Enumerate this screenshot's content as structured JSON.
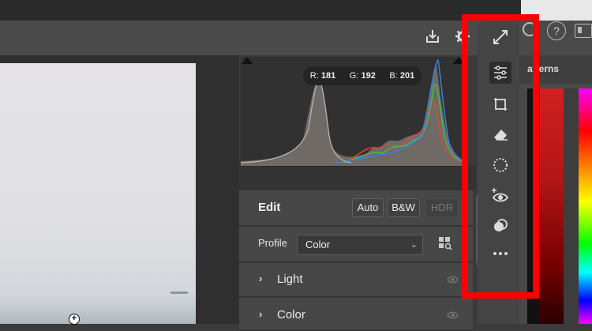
{
  "histogram": {
    "readout": {
      "r_label": "R:",
      "r_value": "181",
      "g_label": "G:",
      "g_value": "192",
      "b_label": "B:",
      "b_value": "201"
    }
  },
  "edit": {
    "title": "Edit",
    "auto_label": "Auto",
    "bw_label": "B&W",
    "hdr_label": "HDR"
  },
  "profile": {
    "label": "Profile",
    "value": "Color"
  },
  "sections": [
    {
      "label": "Light"
    },
    {
      "label": "Color"
    }
  ],
  "right_panel": {
    "tab_label": "atterns"
  },
  "help_label": "?",
  "colors": {
    "highlight": "#ff0000",
    "panel_bg": "#474747",
    "canvas_bg": "#2f2f2f"
  },
  "icons": [
    "download-icon",
    "gear-icon",
    "expand-icon",
    "adjust-sliders-icon",
    "crop-icon",
    "eraser-icon",
    "mask-icon",
    "redeye-icon",
    "presets-icon",
    "more-icon",
    "eye-icon",
    "help-icon",
    "panels-icon"
  ]
}
